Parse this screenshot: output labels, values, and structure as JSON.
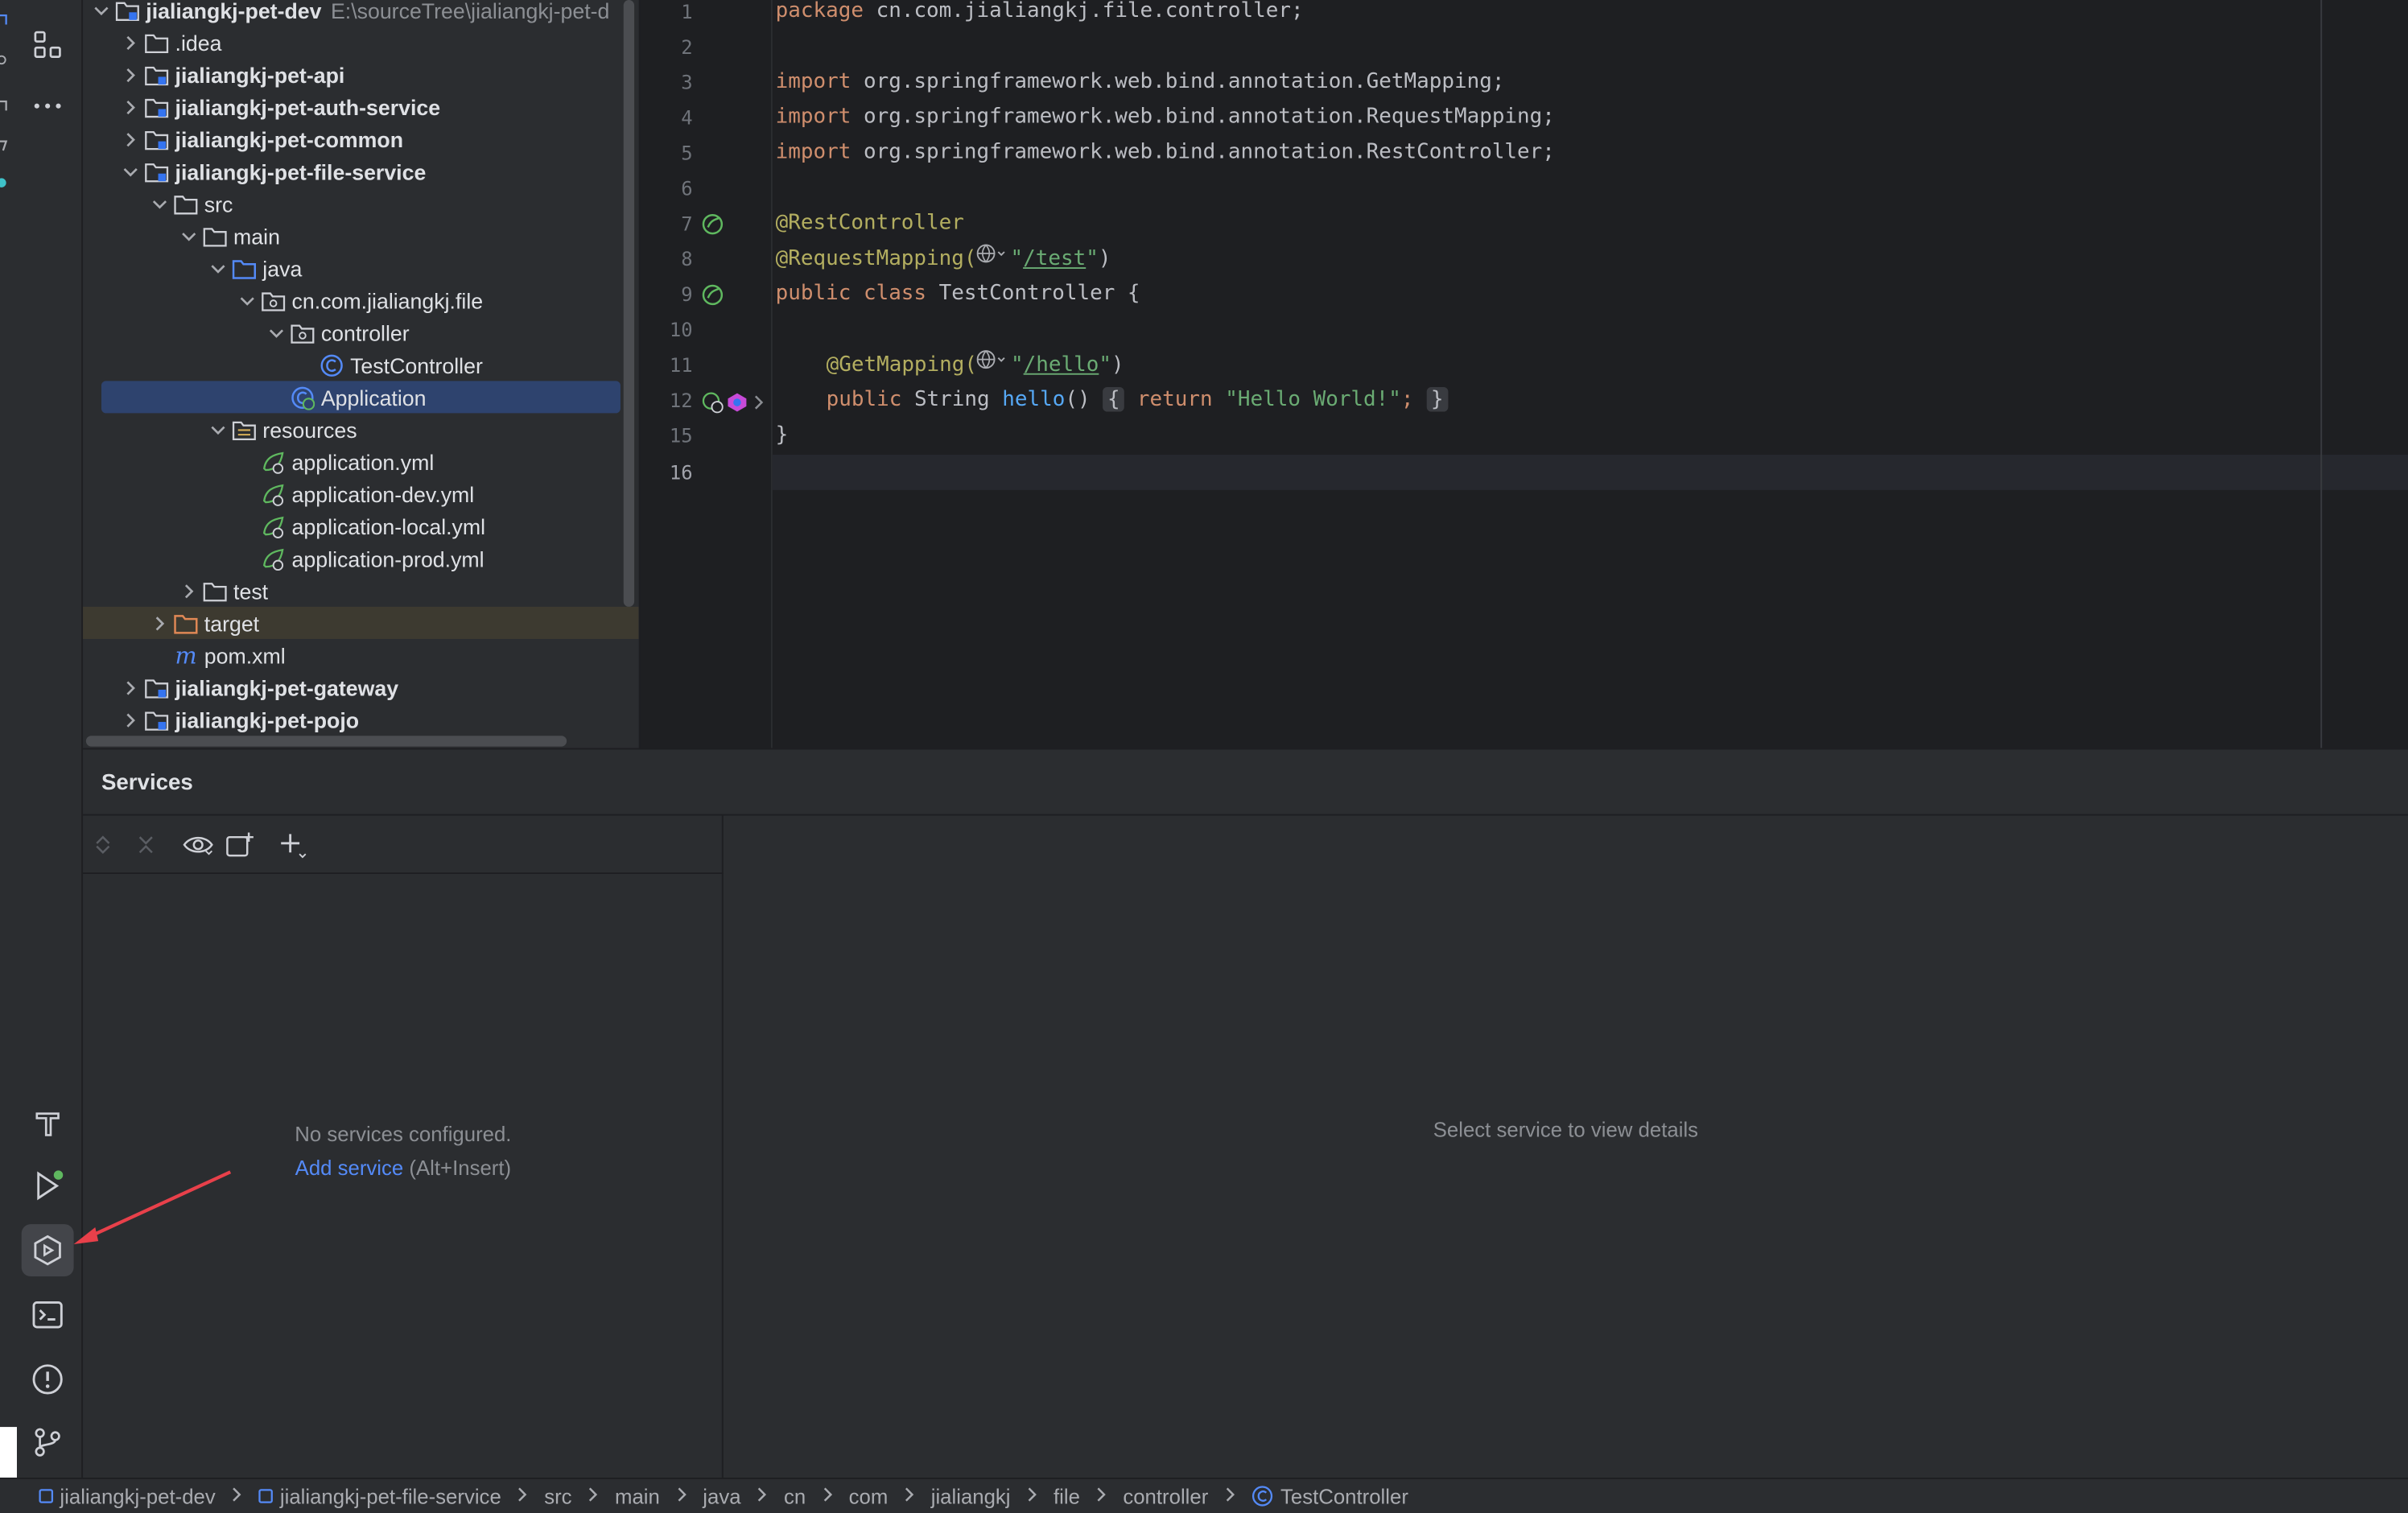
{
  "project": {
    "root": {
      "label": "jialiangkj-pet-dev",
      "path": "E:\\sourceTree\\jialiangkj-pet-d"
    },
    "items": [
      {
        "label": ".idea",
        "kind": "folder",
        "level": 1,
        "chevron": "right"
      },
      {
        "label": "jialiangkj-pet-api",
        "kind": "module",
        "level": 1,
        "chevron": "right",
        "bold": true
      },
      {
        "label": "jialiangkj-pet-auth-service",
        "kind": "module",
        "level": 1,
        "chevron": "right",
        "bold": true
      },
      {
        "label": "jialiangkj-pet-common",
        "kind": "module",
        "level": 1,
        "chevron": "right",
        "bold": true
      },
      {
        "label": "jialiangkj-pet-file-service",
        "kind": "module",
        "level": 1,
        "chevron": "down",
        "bold": true
      },
      {
        "label": "src",
        "kind": "folder",
        "level": 2,
        "chevron": "down"
      },
      {
        "label": "main",
        "kind": "folder",
        "level": 3,
        "chevron": "down"
      },
      {
        "label": "java",
        "kind": "source-folder",
        "level": 4,
        "chevron": "down"
      },
      {
        "label": "cn.com.jialiangkj.file",
        "kind": "package",
        "level": 5,
        "chevron": "down"
      },
      {
        "label": "controller",
        "kind": "package",
        "level": 6,
        "chevron": "down"
      },
      {
        "label": "TestController",
        "kind": "class",
        "level": 7,
        "chevron": "none"
      },
      {
        "label": "Application",
        "kind": "spring-class",
        "level": 6,
        "chevron": "none",
        "selected": true
      },
      {
        "label": "resources",
        "kind": "resources-folder",
        "level": 4,
        "chevron": "down"
      },
      {
        "label": "application.yml",
        "kind": "yml",
        "level": 5,
        "chevron": "none"
      },
      {
        "label": "application-dev.yml",
        "kind": "yml",
        "level": 5,
        "chevron": "none"
      },
      {
        "label": "application-local.yml",
        "kind": "yml",
        "level": 5,
        "chevron": "none"
      },
      {
        "label": "application-prod.yml",
        "kind": "yml",
        "level": 5,
        "chevron": "none"
      },
      {
        "label": "test",
        "kind": "folder",
        "level": 3,
        "chevron": "right"
      },
      {
        "label": "target",
        "kind": "excluded-folder",
        "level": 2,
        "chevron": "right",
        "highlight": true
      },
      {
        "label": "pom.xml",
        "kind": "maven",
        "level": 2,
        "chevron": "none"
      },
      {
        "label": "jialiangkj-pet-gateway",
        "kind": "module",
        "level": 1,
        "chevron": "right",
        "bold": true
      },
      {
        "label": "jialiangkj-pet-pojo",
        "kind": "module",
        "level": 1,
        "chevron": "right",
        "bold": true
      }
    ]
  },
  "editor": {
    "line_numbers": [
      "1",
      "2",
      "3",
      "4",
      "5",
      "6",
      "7",
      "8",
      "9",
      "10",
      "11",
      "12",
      "15",
      "16"
    ],
    "current_line": "16",
    "code": {
      "l1_kw": "package",
      "l1_rest": " cn.com.jialiangkj.file.controller;",
      "import_kw": "import",
      "l3_rest": " org.springframework.web.bind.annotation.GetMapping;",
      "l4_rest": " org.springframework.web.bind.annotation.RequestMapping;",
      "l5_rest": " org.springframework.web.bind.annotation.RestController;",
      "l7_ann": "@RestController",
      "l8_ann": "@RequestMapping(",
      "l8_q1": "\"",
      "l8_url": "/test",
      "l8_q2": "\"",
      "l8_close": ")",
      "l9_kw": "public class",
      "l9_rest": " TestController {",
      "l11_ann": "@GetMapping(",
      "l11_url": "/hello",
      "l12_kw": "public",
      "l12_type": " String ",
      "l12_fn": "hello",
      "l12_paren": "() ",
      "l12_brace_open": "{",
      "l12_return": " return ",
      "l12_str": "\"Hello World!\"",
      "l12_semi": ";",
      "l12_brace_close": "}",
      "l15_text": "}"
    }
  },
  "services": {
    "title": "Services",
    "empty_text": "No services configured.",
    "add_link": "Add service",
    "add_shortcut": " (Alt+Insert)",
    "details_placeholder": "Select service to view details"
  },
  "breadcrumb": [
    "jialiangkj-pet-dev",
    "jialiangkj-pet-file-service",
    "src",
    "main",
    "java",
    "cn",
    "com",
    "jialiangkj",
    "file",
    "controller",
    "TestController"
  ],
  "colors": {
    "accent": "#548af7",
    "selection": "#2e436e",
    "annotation_arrow": "#e8404a",
    "spring_green": "#5fb85f"
  },
  "icons": {
    "toolstrip": [
      "structure-icon",
      "more-icon",
      "build-icon",
      "run-icon",
      "services-icon",
      "terminal-icon",
      "problems-icon",
      "git-icon"
    ]
  }
}
